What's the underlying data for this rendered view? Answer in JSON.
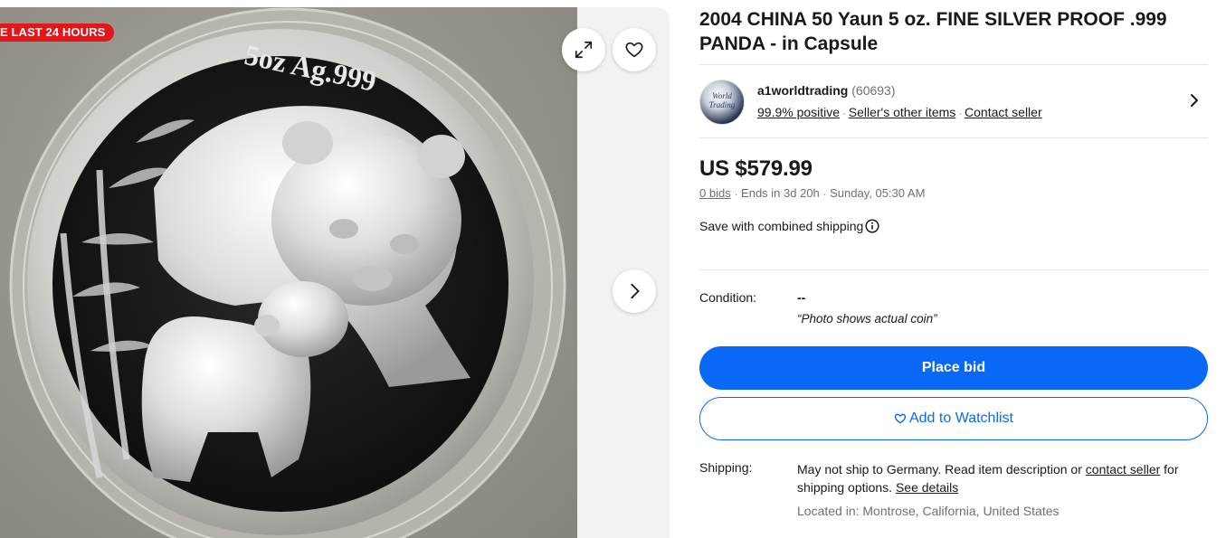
{
  "gallery": {
    "badge": "E LAST 24 HOURS",
    "coin_inscription": "5oz Ag.999",
    "icons": {
      "expand": "expand-icon",
      "watch": "heart-icon",
      "next": "chevron-right-icon"
    }
  },
  "listing": {
    "title": "2004 CHINA 50 Yaun 5 oz. FINE SILVER PROOF .999 PANDA - in Capsule"
  },
  "seller": {
    "name": "a1worldtrading",
    "feedback_count": "(60693)",
    "positive": "99.9% positive",
    "other_items": "Seller's other items",
    "contact": "Contact seller"
  },
  "pricing": {
    "price": "US $579.99",
    "bids": "0 bids",
    "ends_in": "Ends in 3d 20h",
    "end_time": "Sunday, 05:30 AM",
    "combined_shipping": "Save with combined shipping"
  },
  "condition": {
    "label": "Condition:",
    "value": "--",
    "note": "“Photo shows actual coin”"
  },
  "actions": {
    "place_bid": "Place bid",
    "watchlist": "Add to Watchlist"
  },
  "shipping": {
    "label": "Shipping:",
    "text_before": "May not ship to Germany. Read item description or ",
    "contact_link": "contact seller",
    "text_after": " for shipping options. ",
    "details_link": "See details",
    "location_label": "Located in:",
    "location": "Montrose, California, United States"
  },
  "colors": {
    "accent": "#0968f6",
    "badge": "#e0171b",
    "muted_text": "#707070"
  }
}
